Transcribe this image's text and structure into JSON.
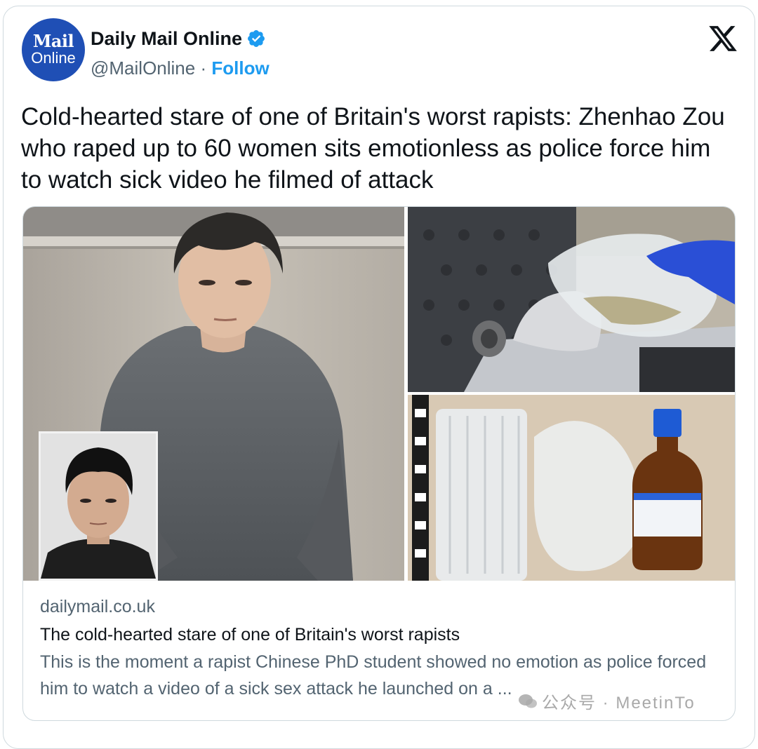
{
  "account": {
    "avatar_line1": "Mail",
    "avatar_line2": "Online",
    "display_name": "Daily Mail Online",
    "handle": "@MailOnline",
    "separator": "·",
    "follow_label": "Follow",
    "verified_icon": "verified-badge-icon",
    "platform_icon": "x-logo-icon"
  },
  "tweet": {
    "text": "Cold-hearted stare of one of Britain's worst rapists: Zhenhao Zou who raped up to 60 women sits emotionless as police force him to watch sick video he filmed of attack"
  },
  "link_card": {
    "domain": "dailymail.co.uk",
    "title": "The cold-hearted stare of one of Britain's worst rapists",
    "description": "This is the moment a rapist Chinese PhD student showed no emotion as police forced him to watch a video of a sick sex attack he launched on a ..."
  },
  "watermark": {
    "text": "公众号 · MeetinTo"
  },
  "colors": {
    "accent": "#1d9bf0",
    "avatar_bg": "#1f4fb5",
    "secondary_text": "#536471",
    "primary_text": "#0f1419",
    "border": "#cfd9de"
  }
}
